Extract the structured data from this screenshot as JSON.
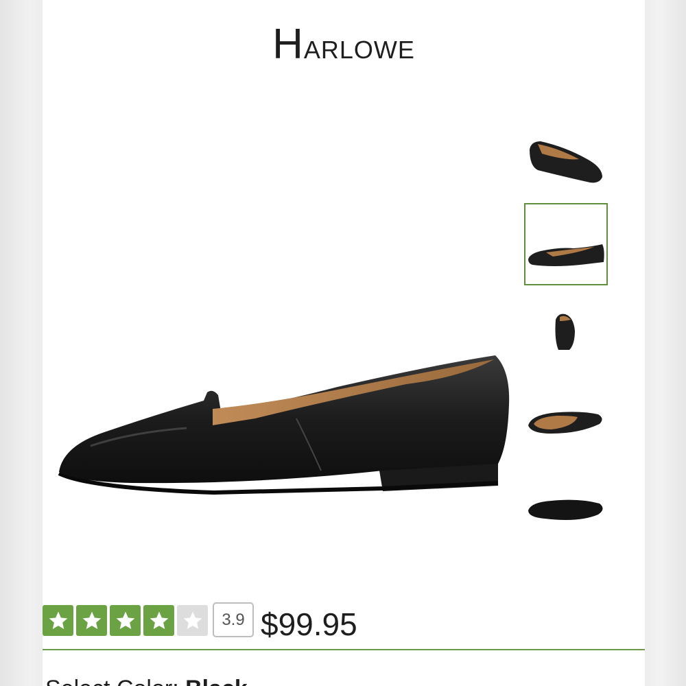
{
  "product": {
    "title_initial": "H",
    "title_rest": "arlowe",
    "rating_value": "3.9",
    "rating_stars": 3.9,
    "price": "$99.95"
  },
  "color_selector": {
    "label": "Select Color: ",
    "selected": "Black"
  },
  "gallery": {
    "thumbnails": [
      "angled view",
      "side view",
      "back view",
      "top view",
      "sole view"
    ],
    "active_index": 1
  },
  "colors": {
    "accent_green": "#6ba344",
    "active_border": "#5f8f3a",
    "leather_black": "#222222",
    "lining_tan": "#b07a46"
  }
}
